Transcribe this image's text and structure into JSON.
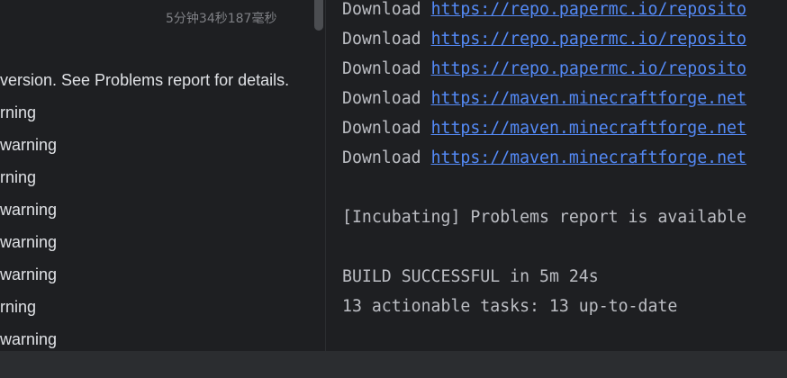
{
  "tree": {
    "duration": "5分钟34秒187毫秒",
    "lines": [
      "version. See Problems report for details.",
      "rning",
      "warning",
      "rning",
      "warning",
      "warning",
      "warning",
      "rning",
      " warning"
    ]
  },
  "console": {
    "downloads": [
      {
        "prefix": "Download ",
        "url": "https://repo.papermc.io/reposito"
      },
      {
        "prefix": "Download ",
        "url": "https://repo.papermc.io/reposito"
      },
      {
        "prefix": "Download ",
        "url": "https://repo.papermc.io/reposito"
      },
      {
        "prefix": "Download ",
        "url": "https://maven.minecraftforge.net"
      },
      {
        "prefix": "Download ",
        "url": "https://maven.minecraftforge.net"
      },
      {
        "prefix": "Download ",
        "url": "https://maven.minecraftforge.net"
      }
    ],
    "problems_line": "[Incubating] Problems report is available",
    "build_result": "BUILD SUCCESSFUL in 5m 24s",
    "tasks_summary": "13 actionable tasks: 13 up-to-date"
  }
}
